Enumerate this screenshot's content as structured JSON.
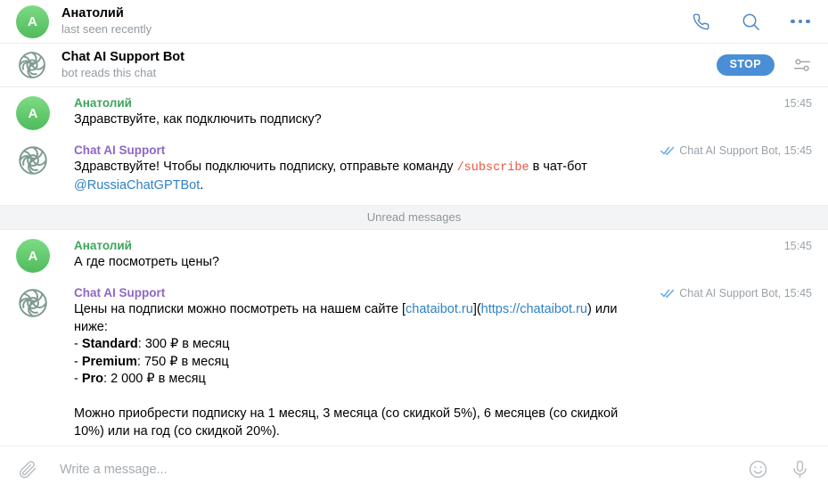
{
  "header": {
    "avatar_letter": "A",
    "avatar_color": "#4fbb5c",
    "title": "Анатолий",
    "subtitle": "last seen recently",
    "call_icon": "phone-icon",
    "search_icon": "search-icon",
    "more_icon": "more-menu-icon",
    "accent_color": "#5288c1"
  },
  "bot_bar": {
    "title": "Chat AI Support Bot",
    "subtitle": "bot reads this chat",
    "stop_label": "STOP",
    "stop_color": "#4a8fd6",
    "settings_icon": "sliders-icon",
    "avatar_icon": "bot-knot-logo-icon"
  },
  "unread_divider": {
    "label": "Unread messages"
  },
  "messages": [
    {
      "author": "Анатолий",
      "author_type": "user",
      "avatar_letter": "A",
      "time": "15:45",
      "signature": "",
      "read": false
    },
    {
      "author": "Chat AI Support",
      "author_type": "bot",
      "time": "15:45",
      "signature": "Chat AI Support Bot, 15:45",
      "read": true
    },
    {
      "author": "Анатолий",
      "author_type": "user",
      "avatar_letter": "A",
      "time": "15:45",
      "signature": "",
      "read": false
    },
    {
      "author": "Chat AI Support",
      "author_type": "bot",
      "time": "15:45",
      "signature": "Chat AI Support Bot, 15:45",
      "read": true
    }
  ],
  "message_text": {
    "m1": "Здравствуйте, как подключить подписку?",
    "m2_part1": "Здравствуйте! Чтобы подключить подписку, отправьте команду ",
    "m2_cmd": "/subscribe",
    "m2_part2": " в чат-бот ",
    "m2_mention": "@RussiaChatGPTBot",
    "m2_part3": ".",
    "m3": "А где посмотреть цены?",
    "m4_lead": "Цены на подписки можно посмотреть на нашем сайте [",
    "m4_link_label": "chataibot.ru",
    "m4_mid": "](",
    "m4_link_url": "https://chataibot.ru",
    "m4_after": ") или ниже:",
    "m4_tier1_name": "Standard",
    "m4_tier1_price": ": 300 ₽ в месяц",
    "m4_tier2_name": "Premium",
    "m4_tier2_price": ": 750 ₽ в месяц",
    "m4_tier3_name": "Pro",
    "m4_tier3_price": ": 2 000 ₽ в месяц",
    "m4_footer": "Можно приобрести подписку на 1 месяц, 3 месяца (со скидкой 5%), 6 месяцев (со скидкой 10%) или на год (со скидкой 20%)."
  },
  "composer": {
    "attach_icon": "paperclip-icon",
    "placeholder": "Write a message...",
    "value": "",
    "emoji_icon": "smiley-icon",
    "mic_icon": "microphone-icon"
  }
}
